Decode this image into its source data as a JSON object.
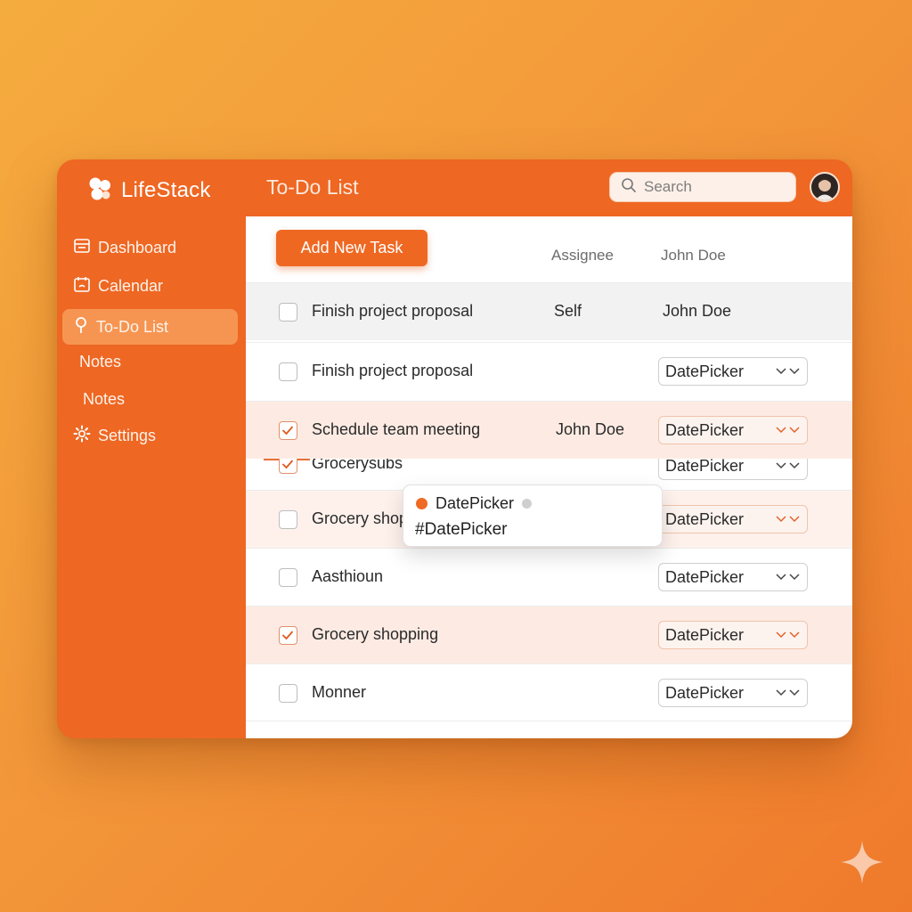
{
  "app": {
    "name": "LifeStack",
    "page_title": "To-Do List"
  },
  "search": {
    "placeholder": "Search"
  },
  "sidebar": {
    "items": [
      {
        "label": "Dashboard"
      },
      {
        "label": "Calendar"
      },
      {
        "label": "To-Do List"
      },
      {
        "label": "Notes"
      },
      {
        "label": "Notes"
      },
      {
        "label": "Settings"
      }
    ]
  },
  "toolbar": {
    "add_label": "Add New Task"
  },
  "columns": {
    "assignee": "Assignee",
    "owner": "John Doe"
  },
  "rows": [
    {
      "task": "Finish project proposal",
      "checked": false,
      "assignee": "Self",
      "owner": "John Doe"
    },
    {
      "task": "Finish project proposal",
      "checked": false,
      "date": "DatePicker"
    },
    {
      "task": "Schedule team meeting",
      "checked": true,
      "assignee": "John Doe",
      "date": "DatePicker"
    },
    {
      "task": "Grocerysubs",
      "checked": true,
      "date": "DatePicker"
    },
    {
      "task": "Grocery shopping",
      "checked": false,
      "date": "DatePicker"
    },
    {
      "task": "Aasthioun",
      "checked": false,
      "date": "DatePicker"
    },
    {
      "task": "Grocery shopping",
      "checked": true,
      "date": "DatePicker"
    },
    {
      "task": "Monner",
      "checked": false,
      "date": "DatePicker"
    }
  ],
  "popover": {
    "title": "DatePicker",
    "tag": "#DatePicker"
  },
  "colors": {
    "accent": "#EE6723",
    "sidebar_active": "#F69552",
    "row_highlight": "#FDEBE3"
  }
}
